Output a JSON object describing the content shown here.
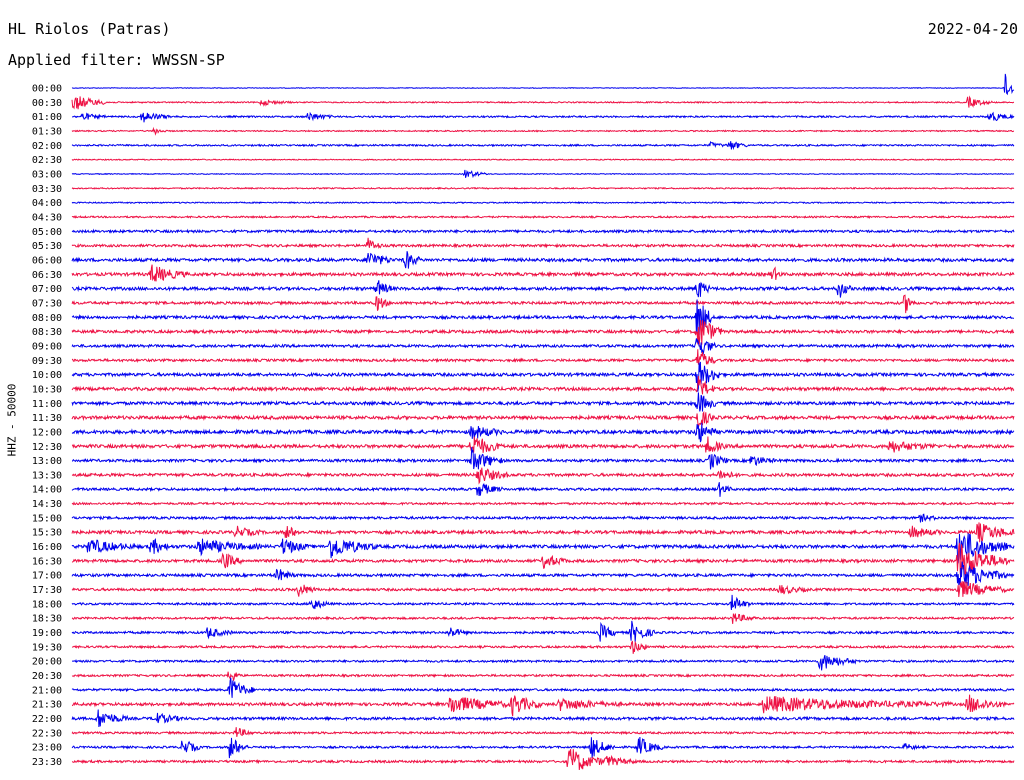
{
  "header": {
    "station": "HL Riolos (Patras)",
    "date": "2022-04-20",
    "filter": "Applied filter: WWSSN-SP"
  },
  "chart_data": {
    "type": "line",
    "title": "HL Riolos (Patras)",
    "ylabel": "HHZ - 50000",
    "xlabel": "",
    "colors": {
      "even_rows": "#0000ee",
      "odd_rows": "#ee1144"
    },
    "x_unit": "minutes after row start",
    "xlim": [
      0,
      30
    ],
    "rows": [
      "00:00",
      "00:30",
      "01:00",
      "01:30",
      "02:00",
      "02:30",
      "03:00",
      "03:30",
      "04:00",
      "04:30",
      "05:00",
      "05:30",
      "06:00",
      "06:30",
      "07:00",
      "07:30",
      "08:00",
      "08:30",
      "09:00",
      "09:30",
      "10:00",
      "10:30",
      "11:00",
      "11:30",
      "12:00",
      "12:30",
      "13:00",
      "13:30",
      "14:00",
      "14:30",
      "15:00",
      "15:30",
      "16:00",
      "16:30",
      "17:00",
      "17:30",
      "18:00",
      "18:30",
      "19:00",
      "19:30",
      "20:00",
      "20:30",
      "21:00",
      "21:30",
      "22:00",
      "22:30",
      "23:00",
      "23:30"
    ],
    "noise": [
      0.3,
      0.6,
      0.8,
      0.6,
      0.8,
      0.5,
      0.4,
      0.6,
      0.6,
      0.8,
      1.2,
      1.2,
      1.5,
      1.5,
      1.5,
      1.3,
      1.4,
      1.4,
      1.3,
      1.2,
      1.5,
      1.5,
      1.5,
      1.6,
      1.7,
      1.6,
      1.3,
      1.4,
      1.2,
      1.0,
      1.2,
      1.5,
      1.6,
      1.4,
      1.3,
      1.2,
      1.0,
      1.0,
      1.1,
      1.0,
      1.0,
      1.0,
      1.1,
      1.4,
      1.3,
      1.0,
      1.0,
      1.1
    ],
    "events": [
      {
        "row": 0,
        "t": 29.7,
        "amp": 18,
        "dur": 0.4
      },
      {
        "row": 1,
        "t": 0.0,
        "amp": 9,
        "dur": 1.2
      },
      {
        "row": 1,
        "t": 6.0,
        "amp": 3,
        "dur": 1.0
      },
      {
        "row": 1,
        "t": 28.5,
        "amp": 6,
        "dur": 0.8
      },
      {
        "row": 2,
        "t": 0.3,
        "amp": 4,
        "dur": 0.8
      },
      {
        "row": 2,
        "t": 2.2,
        "amp": 6,
        "dur": 1.0
      },
      {
        "row": 2,
        "t": 7.5,
        "amp": 5,
        "dur": 0.8
      },
      {
        "row": 2,
        "t": 29.2,
        "amp": 6,
        "dur": 0.8
      },
      {
        "row": 3,
        "t": 2.6,
        "amp": 4,
        "dur": 0.4
      },
      {
        "row": 4,
        "t": 20.3,
        "amp": 3,
        "dur": 0.6
      },
      {
        "row": 4,
        "t": 20.9,
        "amp": 6,
        "dur": 0.6
      },
      {
        "row": 6,
        "t": 12.5,
        "amp": 5,
        "dur": 0.8
      },
      {
        "row": 11,
        "t": 9.4,
        "amp": 8,
        "dur": 0.5
      },
      {
        "row": 12,
        "t": 9.4,
        "amp": 10,
        "dur": 0.8
      },
      {
        "row": 12,
        "t": 10.6,
        "amp": 12,
        "dur": 0.5
      },
      {
        "row": 13,
        "t": 2.5,
        "amp": 10,
        "dur": 1.2
      },
      {
        "row": 13,
        "t": 22.3,
        "amp": 10,
        "dur": 0.3
      },
      {
        "row": 14,
        "t": 9.7,
        "amp": 10,
        "dur": 0.5
      },
      {
        "row": 14,
        "t": 19.9,
        "amp": 14,
        "dur": 0.4
      },
      {
        "row": 14,
        "t": 24.4,
        "amp": 12,
        "dur": 0.4
      },
      {
        "row": 15,
        "t": 9.7,
        "amp": 10,
        "dur": 0.4
      },
      {
        "row": 15,
        "t": 26.5,
        "amp": 12,
        "dur": 0.4
      },
      {
        "row": 16,
        "t": 19.9,
        "amp": 30,
        "dur": 0.5
      },
      {
        "row": 17,
        "t": 19.9,
        "amp": 22,
        "dur": 0.8
      },
      {
        "row": 18,
        "t": 19.9,
        "amp": 16,
        "dur": 0.6
      },
      {
        "row": 19,
        "t": 19.9,
        "amp": 14,
        "dur": 0.6
      },
      {
        "row": 20,
        "t": 19.9,
        "amp": 18,
        "dur": 0.8
      },
      {
        "row": 21,
        "t": 19.9,
        "amp": 14,
        "dur": 0.6
      },
      {
        "row": 22,
        "t": 19.9,
        "amp": 14,
        "dur": 0.6
      },
      {
        "row": 23,
        "t": 19.9,
        "amp": 12,
        "dur": 0.6
      },
      {
        "row": 24,
        "t": 12.7,
        "amp": 8,
        "dur": 1.0
      },
      {
        "row": 24,
        "t": 19.9,
        "amp": 14,
        "dur": 0.6
      },
      {
        "row": 25,
        "t": 12.7,
        "amp": 14,
        "dur": 1.0
      },
      {
        "row": 25,
        "t": 20.2,
        "amp": 10,
        "dur": 0.6
      },
      {
        "row": 25,
        "t": 26.0,
        "amp": 6,
        "dur": 1.5
      },
      {
        "row": 26,
        "t": 12.7,
        "amp": 14,
        "dur": 1.0
      },
      {
        "row": 26,
        "t": 20.3,
        "amp": 10,
        "dur": 0.6
      },
      {
        "row": 26,
        "t": 21.6,
        "amp": 6,
        "dur": 0.8
      },
      {
        "row": 27,
        "t": 12.9,
        "amp": 10,
        "dur": 1.0
      },
      {
        "row": 27,
        "t": 20.6,
        "amp": 6,
        "dur": 0.6
      },
      {
        "row": 28,
        "t": 12.9,
        "amp": 8,
        "dur": 0.8
      },
      {
        "row": 28,
        "t": 20.6,
        "amp": 8,
        "dur": 0.4
      },
      {
        "row": 30,
        "t": 27.0,
        "amp": 4,
        "dur": 0.6
      },
      {
        "row": 31,
        "t": 5.2,
        "amp": 6,
        "dur": 0.8
      },
      {
        "row": 31,
        "t": 6.8,
        "amp": 8,
        "dur": 0.5
      },
      {
        "row": 31,
        "t": 26.7,
        "amp": 6,
        "dur": 1.0
      },
      {
        "row": 31,
        "t": 28.8,
        "amp": 10,
        "dur": 1.5
      },
      {
        "row": 32,
        "t": 0.5,
        "amp": 8,
        "dur": 1.5
      },
      {
        "row": 32,
        "t": 2.5,
        "amp": 10,
        "dur": 0.6
      },
      {
        "row": 32,
        "t": 4.0,
        "amp": 8,
        "dur": 2.0
      },
      {
        "row": 32,
        "t": 6.7,
        "amp": 10,
        "dur": 0.8
      },
      {
        "row": 32,
        "t": 8.2,
        "amp": 12,
        "dur": 1.5
      },
      {
        "row": 32,
        "t": 28.2,
        "amp": 20,
        "dur": 1.6
      },
      {
        "row": 33,
        "t": 4.8,
        "amp": 10,
        "dur": 0.6
      },
      {
        "row": 33,
        "t": 15.0,
        "amp": 8,
        "dur": 0.8
      },
      {
        "row": 33,
        "t": 28.2,
        "amp": 22,
        "dur": 1.6
      },
      {
        "row": 34,
        "t": 6.5,
        "amp": 8,
        "dur": 0.6
      },
      {
        "row": 34,
        "t": 28.2,
        "amp": 16,
        "dur": 1.6
      },
      {
        "row": 35,
        "t": 7.2,
        "amp": 8,
        "dur": 0.6
      },
      {
        "row": 35,
        "t": 22.5,
        "amp": 5,
        "dur": 1.0
      },
      {
        "row": 35,
        "t": 28.2,
        "amp": 10,
        "dur": 1.6
      },
      {
        "row": 36,
        "t": 7.6,
        "amp": 8,
        "dur": 0.6
      },
      {
        "row": 36,
        "t": 21.0,
        "amp": 10,
        "dur": 0.6
      },
      {
        "row": 37,
        "t": 21.0,
        "amp": 6,
        "dur": 0.8
      },
      {
        "row": 38,
        "t": 4.3,
        "amp": 6,
        "dur": 0.8
      },
      {
        "row": 38,
        "t": 12.0,
        "amp": 6,
        "dur": 0.6
      },
      {
        "row": 38,
        "t": 16.8,
        "amp": 10,
        "dur": 0.6
      },
      {
        "row": 38,
        "t": 17.8,
        "amp": 12,
        "dur": 0.8
      },
      {
        "row": 39,
        "t": 17.8,
        "amp": 8,
        "dur": 0.6
      },
      {
        "row": 40,
        "t": 23.8,
        "amp": 10,
        "dur": 1.2
      },
      {
        "row": 41,
        "t": 5.0,
        "amp": 10,
        "dur": 0.4
      },
      {
        "row": 42,
        "t": 5.0,
        "amp": 14,
        "dur": 0.8
      },
      {
        "row": 43,
        "t": 12.0,
        "amp": 10,
        "dur": 2.0
      },
      {
        "row": 43,
        "t": 14.0,
        "amp": 12,
        "dur": 1.0
      },
      {
        "row": 43,
        "t": 15.5,
        "amp": 6,
        "dur": 2.0
      },
      {
        "row": 43,
        "t": 22.0,
        "amp": 8,
        "dur": 6.0
      },
      {
        "row": 43,
        "t": 28.5,
        "amp": 10,
        "dur": 1.2
      },
      {
        "row": 44,
        "t": 0.8,
        "amp": 10,
        "dur": 1.0
      },
      {
        "row": 44,
        "t": 2.6,
        "amp": 6,
        "dur": 1.0
      },
      {
        "row": 45,
        "t": 5.2,
        "amp": 6,
        "dur": 0.6
      },
      {
        "row": 46,
        "t": 3.5,
        "amp": 10,
        "dur": 0.6
      },
      {
        "row": 46,
        "t": 5.0,
        "amp": 14,
        "dur": 0.6
      },
      {
        "row": 46,
        "t": 16.5,
        "amp": 12,
        "dur": 0.8
      },
      {
        "row": 46,
        "t": 18.0,
        "amp": 12,
        "dur": 0.8
      },
      {
        "row": 46,
        "t": 26.5,
        "amp": 4,
        "dur": 0.5
      },
      {
        "row": 47,
        "t": 15.8,
        "amp": 16,
        "dur": 1.2
      },
      {
        "row": 47,
        "t": 17.0,
        "amp": 6,
        "dur": 1.0
      }
    ]
  }
}
